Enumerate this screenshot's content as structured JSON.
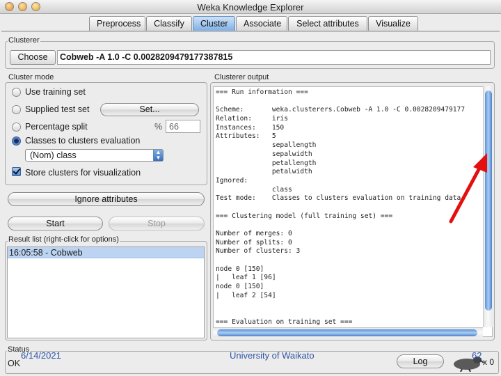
{
  "window": {
    "title": "Weka Knowledge Explorer"
  },
  "tabs": [
    {
      "label": "Preprocess",
      "active": false
    },
    {
      "label": "Classify",
      "active": false
    },
    {
      "label": "Cluster",
      "active": true
    },
    {
      "label": "Associate",
      "active": false
    },
    {
      "label": "Select attributes",
      "active": false
    },
    {
      "label": "Visualize",
      "active": false
    }
  ],
  "clusterer": {
    "group_label": "Clusterer",
    "choose_label": "Choose",
    "config": "Cobweb -A 1.0 -C 0.0028209479177387815"
  },
  "cluster_mode": {
    "group_label": "Cluster mode",
    "use_training_set": "Use training set",
    "supplied_test_set": "Supplied test set",
    "set_button": "Set...",
    "percentage_split": "Percentage split",
    "percent_sign": "%",
    "percent_value": "66",
    "classes_to_clusters": "Classes to clusters evaluation",
    "class_select": "(Nom) class",
    "store_clusters": "Store clusters for visualization",
    "selected": "classes_to_clusters",
    "store_checked": true
  },
  "ignore_attributes_label": "Ignore attributes",
  "start_label": "Start",
  "stop_label": "Stop",
  "result_list": {
    "group_label": "Result list (right-click for options)",
    "items": [
      "16:05:58 - Cobweb"
    ]
  },
  "output": {
    "group_label": "Clusterer output",
    "lines": [
      "=== Run information ===",
      "",
      "Scheme:       weka.clusterers.Cobweb -A 1.0 -C 0.0028209479177",
      "Relation:     iris",
      "Instances:    150",
      "Attributes:   5",
      "              sepallength",
      "              sepalwidth",
      "              petallength",
      "              petalwidth",
      "Ignored:",
      "              class",
      "Test mode:    Classes to clusters evaluation on training data",
      "",
      "=== Clustering model (full training set) ===",
      "",
      "Number of merges: 0",
      "Number of splits: 0",
      "Number of clusters: 3",
      "",
      "node 0 [150]",
      "|   leaf 1 [96]",
      "node 0 [150]",
      "|   leaf 2 [54]",
      "",
      "",
      "=== Evaluation on training set ==="
    ]
  },
  "status": {
    "group_label": "Status",
    "text": "OK",
    "log_label": "Log",
    "x_count": "x 0"
  },
  "footer": {
    "date": "6/14/2021",
    "org": "University of Waikato",
    "page": "62"
  },
  "colors": {
    "tab_active": "#7fb0e6",
    "selection": "#bcd4f2",
    "arrow": "#e41010",
    "footer_text": "#2f55a8"
  }
}
